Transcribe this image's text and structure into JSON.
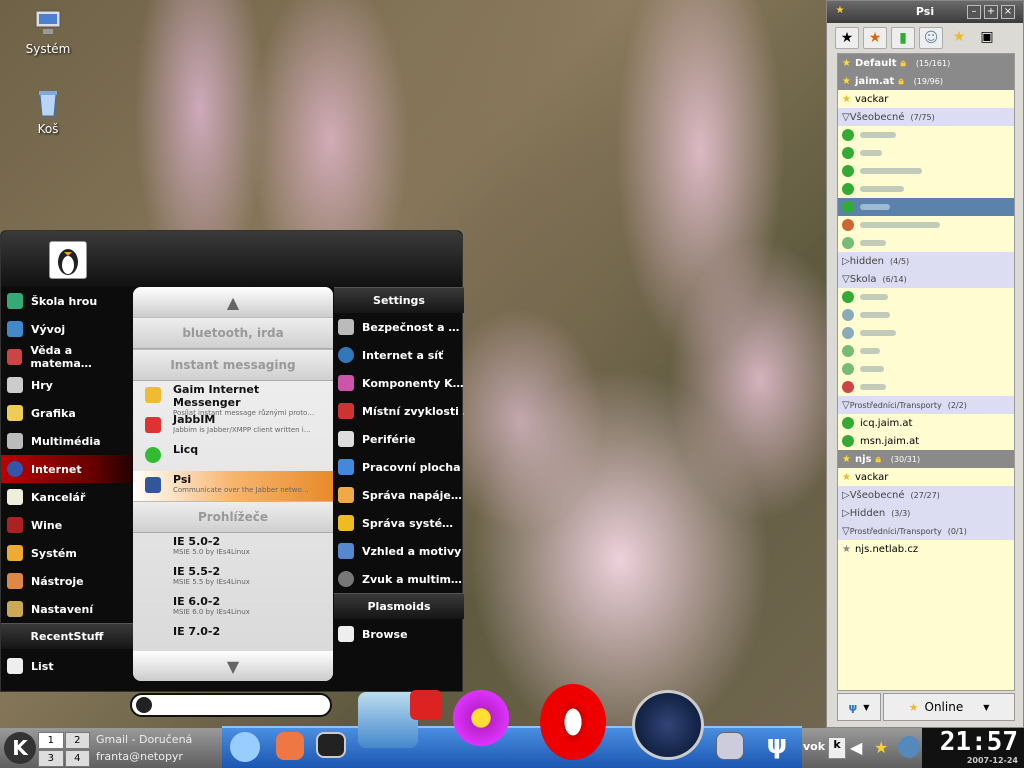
{
  "desktop": {
    "icons": [
      {
        "label": "Systém",
        "icon": "computer-icon"
      },
      {
        "label": "Koš",
        "icon": "trash-icon"
      }
    ]
  },
  "menu": {
    "categories": [
      "Škola hrou",
      "Vývoj",
      "Věda a matema…",
      "Hry",
      "Grafika",
      "Multimédia",
      "Internet",
      "Kancelář",
      "Wine",
      "Systém",
      "Nástroje",
      "Nastavení"
    ],
    "selected_category": "Internet",
    "recent_header": "RecentStuff",
    "recent_item": "List",
    "groups": {
      "bluetooth": "bluetooth, irda",
      "im": "Instant messaging",
      "browsers": "Prohlížeče"
    },
    "im_apps": [
      {
        "name": "Gaim Internet Messenger",
        "desc": "Posílat instant message různými proto…"
      },
      {
        "name": "JabbIM",
        "desc": "Jabbim is Jabber/XMPP client written i…"
      },
      {
        "name": "Licq",
        "desc": ""
      },
      {
        "name": "Psi",
        "desc": "Communicate over the Jabber netwo…"
      }
    ],
    "browser_apps": [
      {
        "name": "IE 5.0-2",
        "desc": "MSIE 5.0 by IEs4Linux"
      },
      {
        "name": "IE 5.5-2",
        "desc": "MSIE 5.5 by IEs4Linux"
      },
      {
        "name": "IE 6.0-2",
        "desc": "MSIE 6.0 by IEs4Linux"
      },
      {
        "name": "IE 7.0-2",
        "desc": ""
      }
    ],
    "settings_header": "Settings",
    "settings": [
      "Bezpečnost a …",
      "Internet a síť",
      "Komponenty K…",
      "Místní zvyklosti …",
      "Periférie",
      "Pracovní plocha",
      "Správa napáje…",
      "Správa systé…",
      "Vzhled a motivy",
      "Zvuk a multim…"
    ],
    "plasmoids_header": "Plasmoids",
    "plasmoids": [
      "Browse"
    ]
  },
  "psi": {
    "title": "Psi",
    "accounts": [
      {
        "name": "Default",
        "count": "(15/161)"
      },
      {
        "name": "jaim.at",
        "count": "(19/96)"
      },
      {
        "name": "njs",
        "count": "(30/31)"
      }
    ],
    "contacts": {
      "vackar": "vackar",
      "g1": {
        "name": "Všeobecné",
        "count": "(7/75)"
      },
      "hidden": {
        "name": "hidden",
        "count": "(4/5)"
      },
      "skola": {
        "name": "Skola",
        "count": "(6/14)"
      },
      "prost": {
        "name": "Prostředníci/Transporty",
        "count": "(2/2)"
      },
      "icq": "icq.jaim.at",
      "msn": "msn.jaim.at",
      "njs_vackar": "vackar",
      "njs_g1": {
        "name": "Všeobecné",
        "count": "(27/27)"
      },
      "njs_hidden": {
        "name": "Hidden",
        "count": "(3/3)"
      },
      "njs_prost": {
        "name": "Prostředníci/Transporty",
        "count": "(0/1)"
      },
      "netlab": "njs.netlab.cz"
    },
    "status": "Online"
  },
  "taskbar": {
    "pager": [
      "1",
      "2",
      "3",
      "4"
    ],
    "task_line1": "Gmail - Doručená",
    "task_line2": "franta@netopyr",
    "tray_text": "vok",
    "clock": "21:57",
    "date": "2007-12-24"
  }
}
